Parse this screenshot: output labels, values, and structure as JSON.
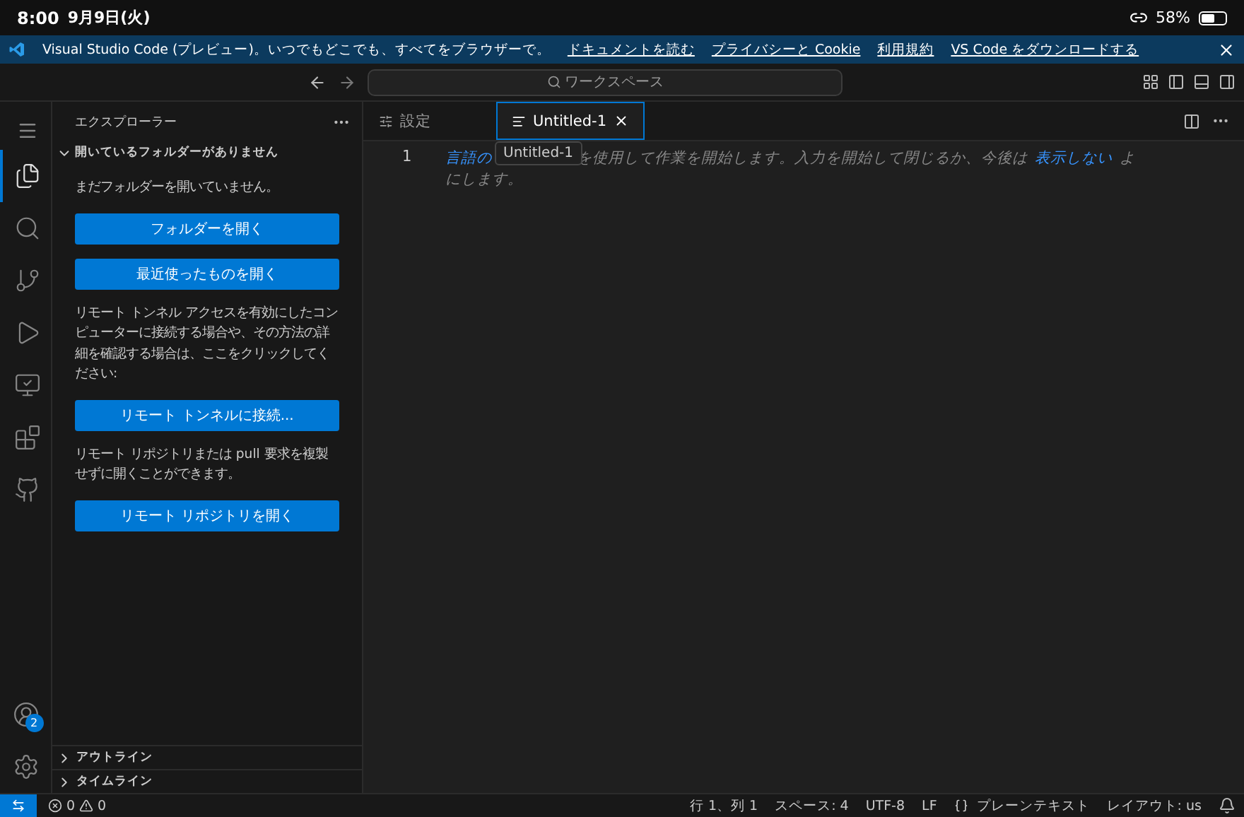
{
  "device_status": {
    "time": "8:00",
    "date": "9月9日(火)",
    "battery": "58%"
  },
  "banner": {
    "text": "Visual Studio Code (プレビュー)。いつでもどこでも、すべてをブラウザーで。",
    "links": [
      "ドキュメントを読む",
      "プライバシーと Cookie",
      "利用規約",
      "VS Code をダウンロードする"
    ]
  },
  "title_bar": {
    "command_center": "ワークスペース"
  },
  "activity_bar": {
    "items": [
      {
        "kind": "explorer",
        "selected": true
      },
      {
        "kind": "search",
        "selected": false
      },
      {
        "kind": "source-control",
        "selected": false
      },
      {
        "kind": "run-debug",
        "selected": false
      },
      {
        "kind": "remote",
        "selected": false
      },
      {
        "kind": "extensions",
        "selected": false
      },
      {
        "kind": "github",
        "selected": false
      }
    ],
    "accounts_badge": "2"
  },
  "sidebar": {
    "title": "エクスプローラー",
    "section": {
      "title": "開いているフォルダーがありません",
      "expanded": true,
      "content": [
        {
          "kind": "text",
          "text": "まだフォルダーを開いていません。"
        },
        {
          "kind": "button",
          "text": "フォルダーを開く"
        },
        {
          "kind": "button",
          "text": "最近使ったものを開く"
        },
        {
          "kind": "text",
          "text": "リモート トンネル アクセスを有効にしたコンピューターに接続する場合や、その方法の詳細を確認する場合は、ここをクリックしてください:"
        },
        {
          "kind": "button",
          "text": "リモート トンネルに接続..."
        },
        {
          "kind": "text",
          "text": "リモート リポジトリまたは pull 要求を複製せずに開くことができます。"
        },
        {
          "kind": "button",
          "text": "リモート リポジトリを開く"
        }
      ]
    },
    "collapsed_sections": [
      {
        "title": "アウトライン",
        "expanded": false
      },
      {
        "title": "タイムライン",
        "expanded": false
      }
    ]
  },
  "tabs": [
    {
      "label": "設定",
      "kind": "settings",
      "selected": false
    },
    {
      "label": "Untitled-1",
      "kind": "file",
      "selected": true
    }
  ],
  "editor": {
    "line_number": "1",
    "tooltip": "Untitled-1",
    "hint_line_1": [
      {
        "kind": "link",
        "text": "言語の"
      },
      {
        "kind": "gap"
      },
      {
        "kind": "text",
        "text": "を使用して作業を開始します。入力を開始して閉じるか、今後は"
      },
      {
        "kind": "link",
        "text": "表示しない"
      },
      {
        "kind": "text",
        "text": "よ"
      }
    ],
    "hint_line_2": "にします。"
  },
  "status_bar": {
    "errors": "0",
    "warnings": "0",
    "items": [
      "行 1、列 1",
      "スペース: 4",
      "UTF-8",
      "LF",
      "プレーンテキスト",
      "レイアウト: us"
    ]
  }
}
